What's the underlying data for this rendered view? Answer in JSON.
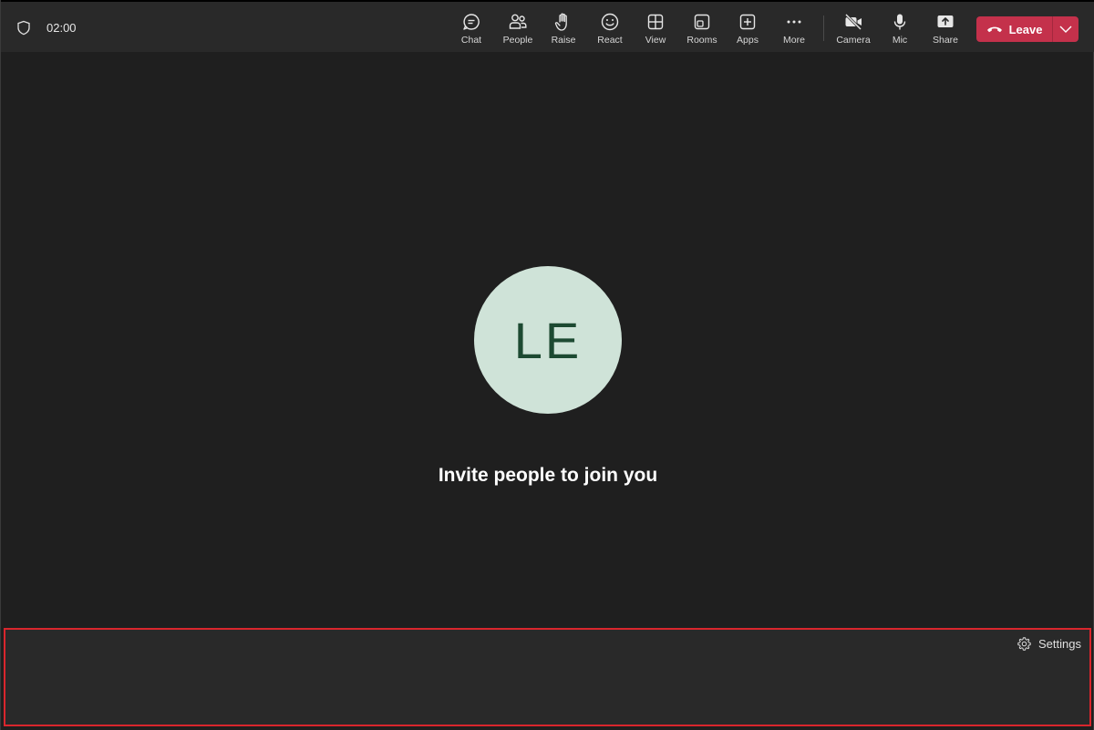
{
  "header": {
    "timer": "02:00",
    "tools": [
      {
        "label": "Chat",
        "icon": "chat-icon"
      },
      {
        "label": "People",
        "icon": "people-icon"
      },
      {
        "label": "Raise",
        "icon": "hand-icon"
      },
      {
        "label": "React",
        "icon": "smiley-icon"
      },
      {
        "label": "View",
        "icon": "grid-icon"
      },
      {
        "label": "Rooms",
        "icon": "rooms-icon"
      },
      {
        "label": "Apps",
        "icon": "plus-box-icon"
      },
      {
        "label": "More",
        "icon": "ellipsis-icon"
      }
    ],
    "devices": [
      {
        "label": "Camera",
        "icon": "camera-off-icon"
      },
      {
        "label": "Mic",
        "icon": "mic-icon"
      },
      {
        "label": "Share",
        "icon": "share-icon"
      }
    ],
    "leave_label": "Leave"
  },
  "stage": {
    "avatar_initials": "LE",
    "message": "Invite people to join you"
  },
  "footer": {
    "settings_label": "Settings"
  },
  "colors": {
    "leave": "#c4314b",
    "avatar_bg": "#cfe3d8",
    "avatar_text": "#1d4a32",
    "highlight_border": "#d9262d"
  }
}
